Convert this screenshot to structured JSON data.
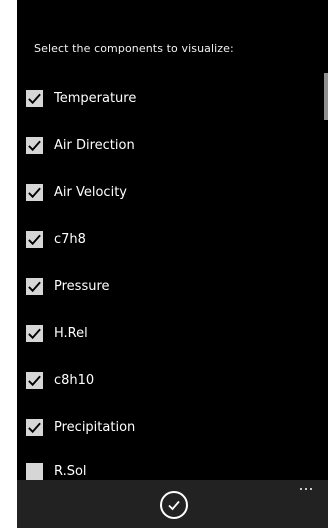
{
  "header": {
    "prompt": "Select the components to visualize:"
  },
  "components": [
    {
      "label": "Temperature",
      "checked": true
    },
    {
      "label": "Air Direction",
      "checked": true
    },
    {
      "label": "Air Velocity",
      "checked": true
    },
    {
      "label": "c7h8",
      "checked": true
    },
    {
      "label": "Pressure",
      "checked": true
    },
    {
      "label": "H.Rel",
      "checked": true
    },
    {
      "label": "c8h10",
      "checked": true
    },
    {
      "label": "Precipitation",
      "checked": true
    },
    {
      "label": "R.Sol",
      "checked": false
    }
  ],
  "app_bar": {
    "confirm_icon": "check-circle-icon",
    "more_icon": "ellipsis-icon"
  },
  "colors": {
    "background": "#000000",
    "text": "#ffffff",
    "checkbox_fill": "#d6d6d6",
    "app_bar": "#222222"
  }
}
